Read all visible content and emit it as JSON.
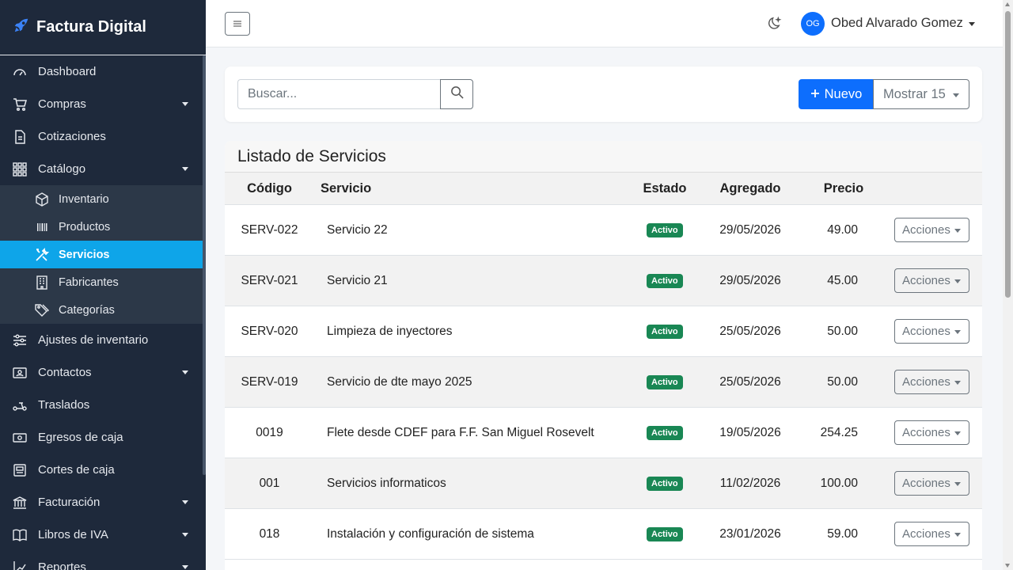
{
  "brand": {
    "title": "Factura Digital"
  },
  "sidebar": {
    "items": [
      {
        "label": "Dashboard",
        "icon": "speedometer-icon"
      },
      {
        "label": "Compras",
        "icon": "cart-icon"
      },
      {
        "label": "Cotizaciones",
        "icon": "document-icon"
      },
      {
        "label": "Catálogo",
        "icon": "grid-icon"
      },
      {
        "label": "Ajustes de inventario",
        "icon": "sliders-icon"
      },
      {
        "label": "Contactos",
        "icon": "contact-card-icon"
      },
      {
        "label": "Traslados",
        "icon": "scooter-icon"
      },
      {
        "label": "Egresos de caja",
        "icon": "cash-icon"
      },
      {
        "label": "Cortes de caja",
        "icon": "register-icon"
      },
      {
        "label": "Facturación",
        "icon": "bank-icon"
      },
      {
        "label": "Libros de IVA",
        "icon": "book-icon"
      },
      {
        "label": "Reportes",
        "icon": "chart-icon"
      }
    ],
    "catalog_sub": [
      {
        "label": "Inventario",
        "icon": "box-icon"
      },
      {
        "label": "Productos",
        "icon": "barcode-icon"
      },
      {
        "label": "Servicios",
        "icon": "tools-icon"
      },
      {
        "label": "Fabricantes",
        "icon": "building-icon"
      },
      {
        "label": "Categorías",
        "icon": "tags-icon"
      }
    ]
  },
  "topbar": {
    "user_initials": "OG",
    "user_name": "Obed Alvarado Gomez"
  },
  "search": {
    "placeholder": "Buscar..."
  },
  "actions": {
    "nuevo": "Nuevo",
    "mostrar": "Mostrar 15"
  },
  "list": {
    "title": "Listado de Servicios",
    "columns": [
      "Código",
      "Servicio",
      "Estado",
      "Agregado",
      "Precio"
    ],
    "action_label": "Acciones",
    "rows": [
      {
        "codigo": "SERV-022",
        "servicio": "Servicio 22",
        "estado": "Activo",
        "agregado": "29/05/2026",
        "precio": "49.00"
      },
      {
        "codigo": "SERV-021",
        "servicio": "Servicio 21",
        "estado": "Activo",
        "agregado": "29/05/2026",
        "precio": "45.00"
      },
      {
        "codigo": "SERV-020",
        "servicio": "Limpieza de inyectores",
        "estado": "Activo",
        "agregado": "25/05/2026",
        "precio": "50.00"
      },
      {
        "codigo": "SERV-019",
        "servicio": "Servicio de dte mayo 2025",
        "estado": "Activo",
        "agregado": "25/05/2026",
        "precio": "50.00"
      },
      {
        "codigo": "0019",
        "servicio": "Flete desde CDEF para F.F. San Miguel Rosevelt",
        "estado": "Activo",
        "agregado": "19/05/2026",
        "precio": "254.25"
      },
      {
        "codigo": "001",
        "servicio": "Servicios informaticos",
        "estado": "Activo",
        "agregado": "11/02/2026",
        "precio": "100.00"
      },
      {
        "codigo": "018",
        "servicio": "Instalación y configuración de sistema",
        "estado": "Activo",
        "agregado": "23/01/2026",
        "precio": "59.00"
      }
    ]
  },
  "colors": {
    "sidebar_bg": "#1e293b",
    "active": "#0ea5e9",
    "primary": "#0d6efd",
    "success": "#198754"
  }
}
